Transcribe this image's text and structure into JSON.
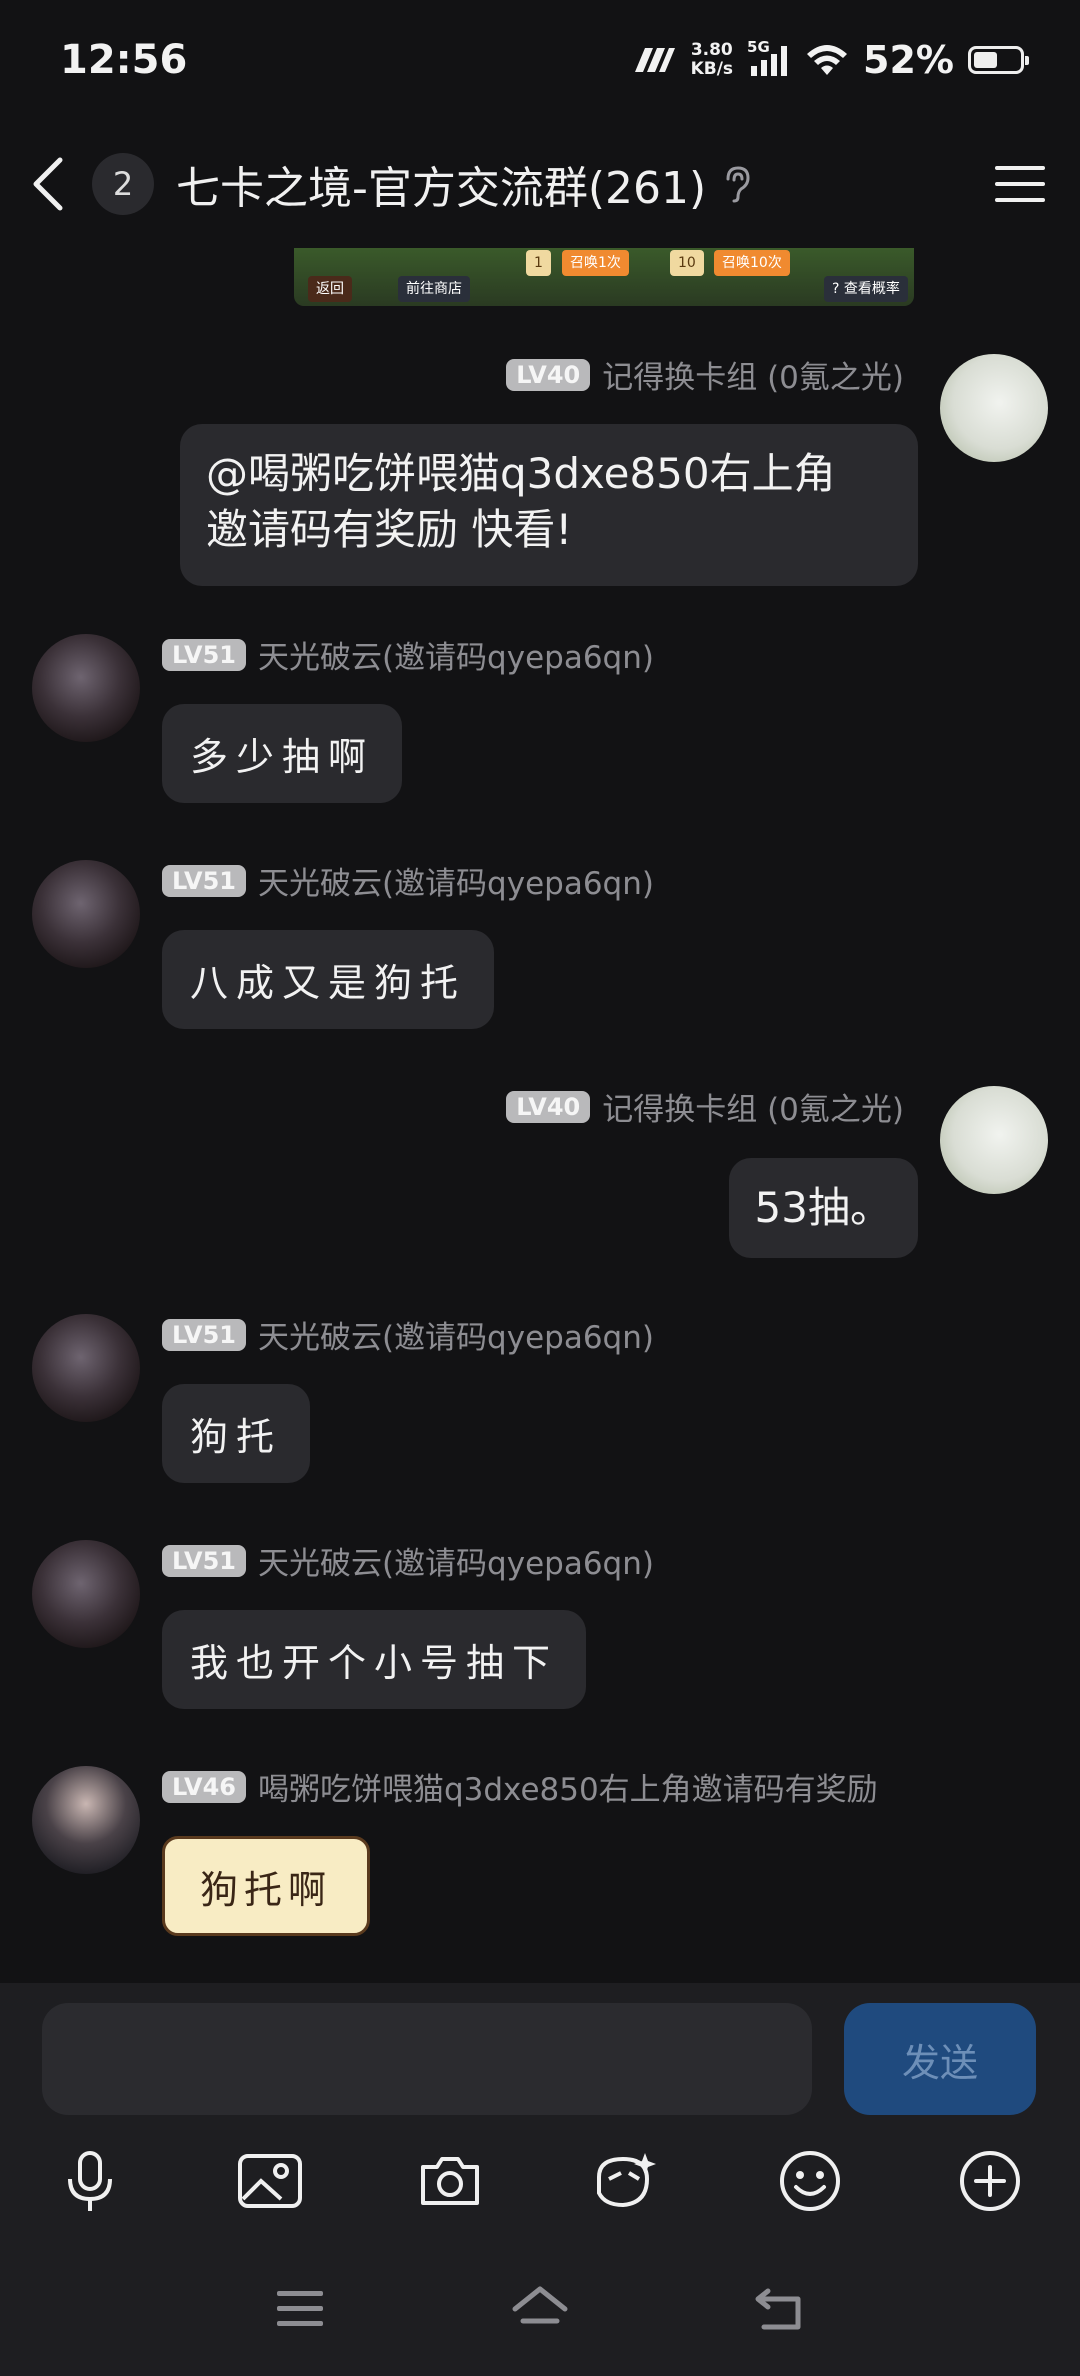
{
  "status_bar": {
    "time": "12:56",
    "network_speed": "3.80",
    "network_speed_unit": "KB/s",
    "network_type": "5G",
    "battery": "52%",
    "battery_level": 0.52
  },
  "header": {
    "unread_count": "2",
    "title": "七卡之境-官方交流群(261)"
  },
  "banner": {
    "back_label": "返回",
    "shop_label": "前往商店",
    "draw_once_count": "1",
    "draw_once_label": "召唤1次",
    "draw_ten_count": "10",
    "draw_ten_label": "召唤10次",
    "rate_label": "? 查看概率"
  },
  "messages": [
    {
      "side": "right",
      "level": "LV40",
      "name": "记得换卡组 (0氪之光)",
      "text": "@喝粥吃饼喂猫q3dxe850右上角邀请码有奖励 快看!",
      "line1": "@喝粥吃饼喂猫q3dxe850右上角",
      "line2": "邀请码有奖励 快看!"
    },
    {
      "side": "left",
      "level": "LV51",
      "name": "天光破云(邀请码qyepa6qn)",
      "text": "多少抽啊"
    },
    {
      "side": "left",
      "level": "LV51",
      "name": "天光破云(邀请码qyepa6qn)",
      "text": "八成又是狗托"
    },
    {
      "side": "right",
      "level": "LV40",
      "name": "记得换卡组 (0氪之光)",
      "text": "53抽。"
    },
    {
      "side": "left",
      "level": "LV51",
      "name": "天光破云(邀请码qyepa6qn)",
      "text": "狗托"
    },
    {
      "side": "left",
      "level": "LV51",
      "name": "天光破云(邀请码qyepa6qn)",
      "text": "我也开个小号抽下"
    },
    {
      "side": "left",
      "level": "LV46",
      "name": "喝粥吃饼喂猫q3dxe850右上角邀请码有奖励",
      "text": "狗托啊"
    }
  ],
  "input": {
    "placeholder": "",
    "send_label": "发送"
  },
  "toolbar": [
    "mic-icon",
    "image-icon",
    "camera-icon",
    "sticker-ai-icon",
    "emoji-icon",
    "plus-icon"
  ],
  "colors": {
    "background": "#121214",
    "bubble": "#2a2a2e",
    "send_button": "#1f4a7e",
    "level_badge": "#b9b9bb"
  }
}
